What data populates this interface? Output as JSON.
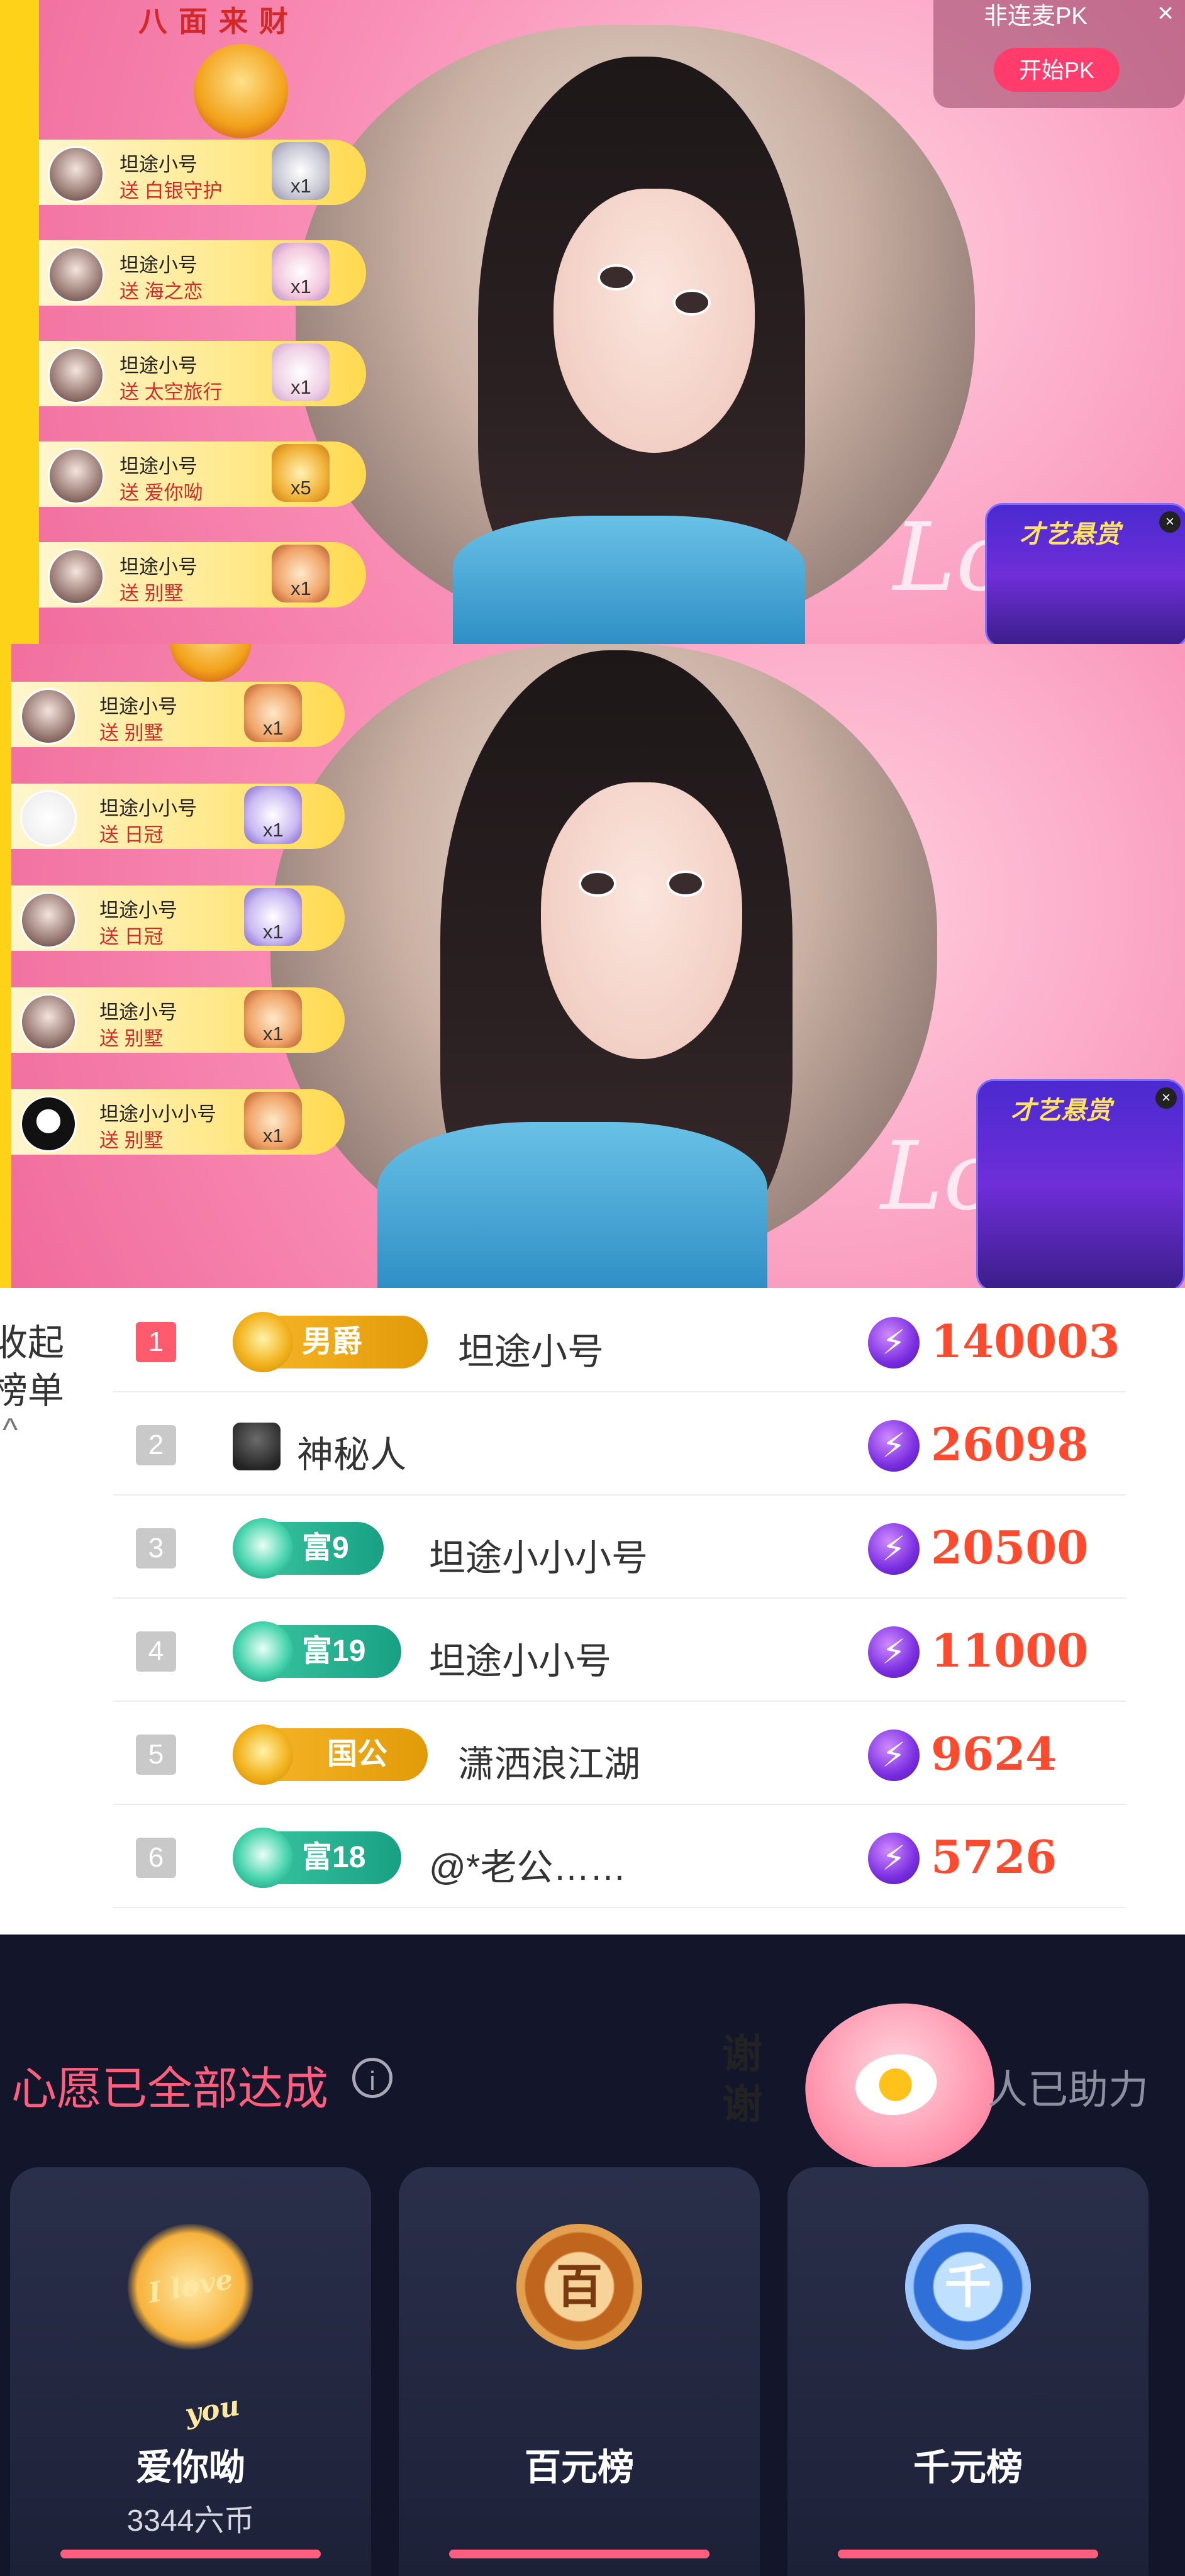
{
  "stream_top": {
    "caishen_title": "八面来财",
    "pk": {
      "label": "非连麦PK",
      "close": "×",
      "button": "开始PK"
    },
    "talent": {
      "title": "才艺悬赏",
      "close": "×"
    },
    "gifts": [
      {
        "user": "坦途小号",
        "action": "送 白银守护",
        "count": "x1"
      },
      {
        "user": "坦途小号",
        "action": "送 海之恋",
        "count": "x1"
      },
      {
        "user": "坦途小号",
        "action": "送 太空旅行",
        "count": "x1"
      },
      {
        "user": "坦途小号",
        "action": "送 爱你呦",
        "count": "x5"
      },
      {
        "user": "坦途小号",
        "action": "送 别墅",
        "count": "x1"
      }
    ]
  },
  "stream_bottom": {
    "talent": {
      "title": "才艺悬赏",
      "close": "×"
    },
    "gifts": [
      {
        "user": "坦途小号",
        "action": "送 别墅",
        "count": "x1"
      },
      {
        "user": "坦途小小号",
        "action": "送 日冠",
        "count": "x1"
      },
      {
        "user": "坦途小号",
        "action": "送 日冠",
        "count": "x1"
      },
      {
        "user": "坦途小号",
        "action": "送 别墅",
        "count": "x1"
      },
      {
        "user": "坦途小小小号",
        "action": "送 别墅",
        "count": "x1"
      }
    ]
  },
  "ranking": {
    "side_label_1": "收起",
    "side_label_2": "榜单",
    "collapse_icon": "^",
    "rows": [
      {
        "rank": "1",
        "badge": "男爵",
        "badge_style": "gold",
        "name": "坦途小号",
        "score": "140003"
      },
      {
        "rank": "2",
        "badge": "",
        "badge_style": "ghost",
        "name": "神秘人",
        "score": "26098"
      },
      {
        "rank": "3",
        "badge": "富9",
        "badge_style": "teal",
        "name": "坦途小小小号",
        "score": "20500"
      },
      {
        "rank": "4",
        "badge": "富19",
        "badge_style": "teal",
        "name": "坦途小小号",
        "score": "11000"
      },
      {
        "rank": "5",
        "badge": "国公",
        "badge_style": "gold",
        "name": "潇洒浪江湖",
        "score": "9624"
      },
      {
        "rank": "6",
        "badge": "富18",
        "badge_style": "teal",
        "name": "@*老公……",
        "score": "5726"
      }
    ]
  },
  "wish": {
    "title": "心愿已全部达成",
    "info_icon": "i",
    "helped_text": "人已助力",
    "thanks_text": "谢谢",
    "cards": [
      {
        "name": "爱你呦",
        "sub": "3344六币",
        "emblem_text": "I love you"
      },
      {
        "name": "百元榜",
        "sub": "",
        "emblem_text": "百"
      },
      {
        "name": "千元榜",
        "sub": "",
        "emblem_text": "千"
      }
    ]
  },
  "colors": {
    "accent_pink": "#ff5f7e",
    "score_red": "#ff4a2d",
    "gift_action_red": "#d22b2b",
    "wish_bg": "#13162b"
  }
}
